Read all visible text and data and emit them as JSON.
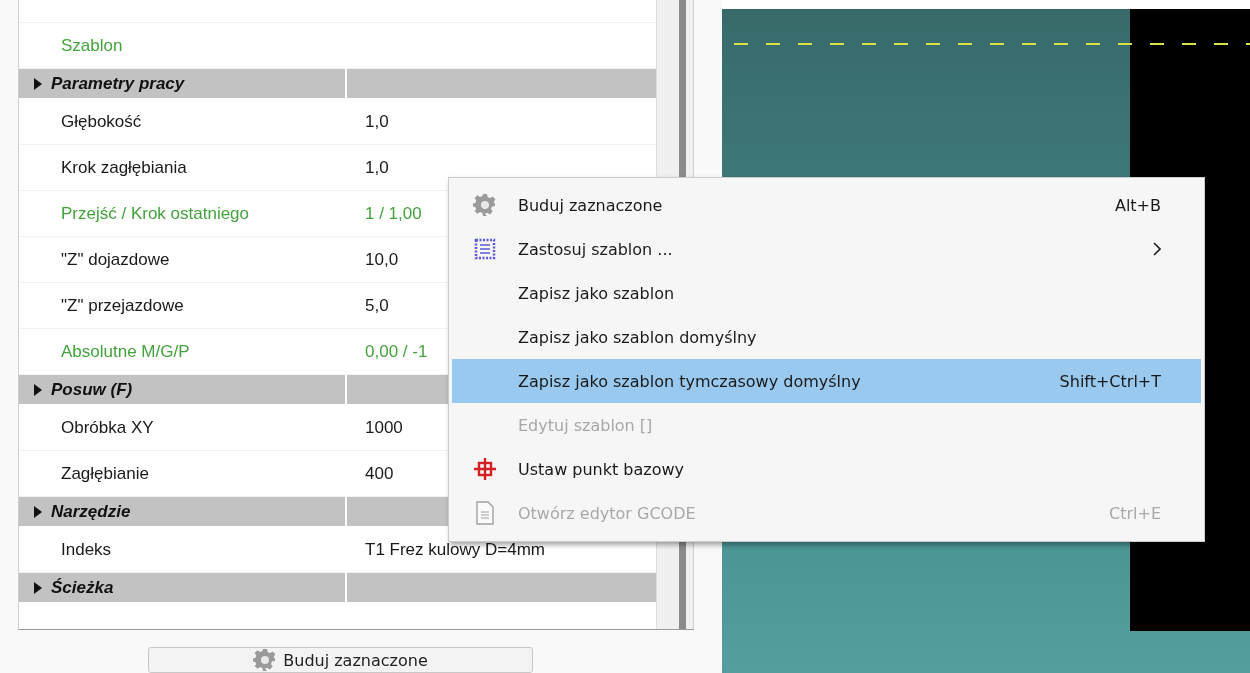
{
  "property_grid": {
    "rows": [
      {
        "kind": "property",
        "label": "Szablon",
        "value": "",
        "modified": true
      },
      {
        "kind": "category",
        "label": "Parametry pracy",
        "expanded": false
      },
      {
        "kind": "property",
        "label": "Głębokość",
        "value": "1,0",
        "modified": false
      },
      {
        "kind": "property",
        "label": "Krok zagłębiania",
        "value": "1,0",
        "modified": false
      },
      {
        "kind": "property",
        "label": "Przejść / Krok ostatniego",
        "value": "1 / 1,00",
        "modified": true
      },
      {
        "kind": "property",
        "label": "\"Z\" dojazdowe",
        "value": "10,0",
        "modified": false
      },
      {
        "kind": "property",
        "label": "\"Z\" przejazdowe",
        "value": "5,0",
        "modified": false
      },
      {
        "kind": "property",
        "label": "Absolutne M/G/P",
        "value": "0,00 / -1",
        "modified": true
      },
      {
        "kind": "category",
        "label": "Posuw (F)",
        "expanded": false
      },
      {
        "kind": "property",
        "label": "Obróbka XY",
        "value": "1000",
        "modified": false
      },
      {
        "kind": "property",
        "label": "Zagłębianie",
        "value": "400",
        "modified": false
      },
      {
        "kind": "category",
        "label": "Narzędzie",
        "expanded": false
      },
      {
        "kind": "property",
        "label": "Indeks",
        "value": "T1 Frez kulowy D=4mm",
        "modified": false
      },
      {
        "kind": "category",
        "label": "Ścieżka",
        "expanded": false
      }
    ]
  },
  "build_button": {
    "label": "Buduj zaznaczone"
  },
  "context_menu": {
    "items": [
      {
        "label": "Buduj zaznaczone",
        "shortcut": "Alt+B",
        "disabled": false,
        "selected": false,
        "submenu": false
      },
      {
        "label": "Zastosuj szablon ...",
        "disabled": false,
        "selected": false,
        "submenu": true
      },
      {
        "label": "Zapisz jako szablon",
        "disabled": false,
        "selected": false,
        "submenu": false
      },
      {
        "label": "Zapisz jako szablon domyślny",
        "disabled": false,
        "selected": false,
        "submenu": false
      },
      {
        "label": "Zapisz jako szablon tymczasowy domyślny",
        "shortcut": "Shift+Ctrl+T",
        "disabled": false,
        "selected": true,
        "submenu": false
      },
      {
        "label": "Edytuj szablon []",
        "disabled": true,
        "selected": false,
        "submenu": false
      },
      {
        "label": "Ustaw punkt bazowy",
        "disabled": false,
        "selected": false,
        "submenu": false
      },
      {
        "label": "Otwórz edytor GCODE",
        "shortcut": "Ctrl+E",
        "disabled": true,
        "selected": false,
        "submenu": false
      }
    ]
  }
}
